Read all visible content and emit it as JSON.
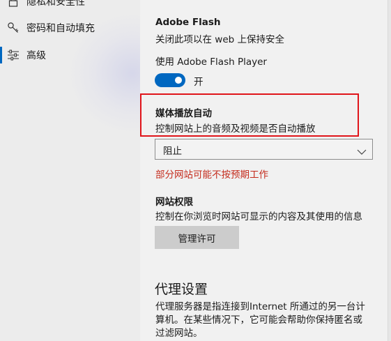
{
  "sidebar": {
    "items": [
      {
        "label": "隐私和安全性",
        "icon": "lock-icon"
      },
      {
        "label": "密码和自动填充",
        "icon": "key-icon"
      },
      {
        "label": "高级",
        "icon": "sliders-icon"
      }
    ]
  },
  "flash": {
    "title": "Adobe Flash",
    "description": "关闭此项以在 web 上保持安全",
    "toggle_label": "使用 Adobe Flash Player",
    "toggle_state": "开"
  },
  "media_autoplay": {
    "title": "媒体播放自动",
    "description": "控制网站上的音频及视频是否自动播放",
    "selected": "阻止",
    "warning": "部分网站可能不按预期工作"
  },
  "site_permissions": {
    "title": "网站权限",
    "description": "控制在你浏览时网站可显示的内容及其使用的信息",
    "button_label": "管理许可"
  },
  "proxy": {
    "title": "代理设置",
    "line1": "代理服务器是指连接到Internet 所通过的另一台计",
    "line2": "算机。在某些情况下，它可能会帮助你保持匿名或",
    "line3": "过滤网站。"
  },
  "colors": {
    "accent": "#0067c0",
    "warning": "#c42b1c",
    "highlight_box": "#e0141a"
  }
}
